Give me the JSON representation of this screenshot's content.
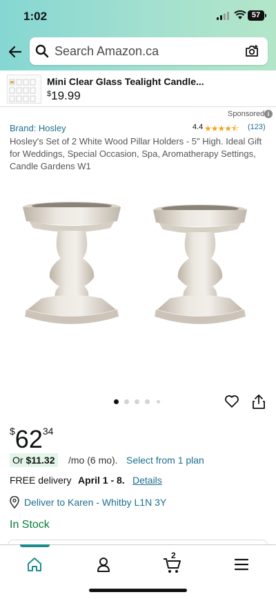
{
  "status_bar": {
    "time": "1:02",
    "battery": "57"
  },
  "search": {
    "placeholder": "Search Amazon.ca"
  },
  "promo": {
    "title": "Mini Clear Glass Tealight Candle...",
    "price_symbol": "$",
    "price_value": "19.99"
  },
  "sponsored_label": "Sponsored",
  "product": {
    "brand": "Brand: Hosley",
    "rating": "4.4",
    "rating_stars_value": 4.4,
    "rating_count": "(123)",
    "title": "Hosley's Set of 2 White Wood Pillar Holders - 5\" High. Ideal Gift for Weddings, Special Occasion, Spa, Aromatherapy Settings, Candle Gardens W1",
    "image_dots": 5,
    "active_dot": 0
  },
  "price": {
    "currency": "$",
    "whole": "62",
    "cents": "34"
  },
  "monthly": {
    "prefix": "Or",
    "amount": "$11.32",
    "suffix": "/mo (6 mo).",
    "link": "Select from 1 plan"
  },
  "delivery": {
    "label": "FREE delivery",
    "date": "April 1 - 8.",
    "details": "Details"
  },
  "deliver_to": "Deliver to Karen - Whitby L1N 3Y",
  "stock": "In Stock",
  "bottom_nav": {
    "cart_count": "2",
    "active_tab": "home"
  },
  "colors": {
    "link": "#1b6f8f",
    "in_stock": "#067d3a",
    "star": "#f4a41c",
    "accent": "#1e8b8b"
  }
}
